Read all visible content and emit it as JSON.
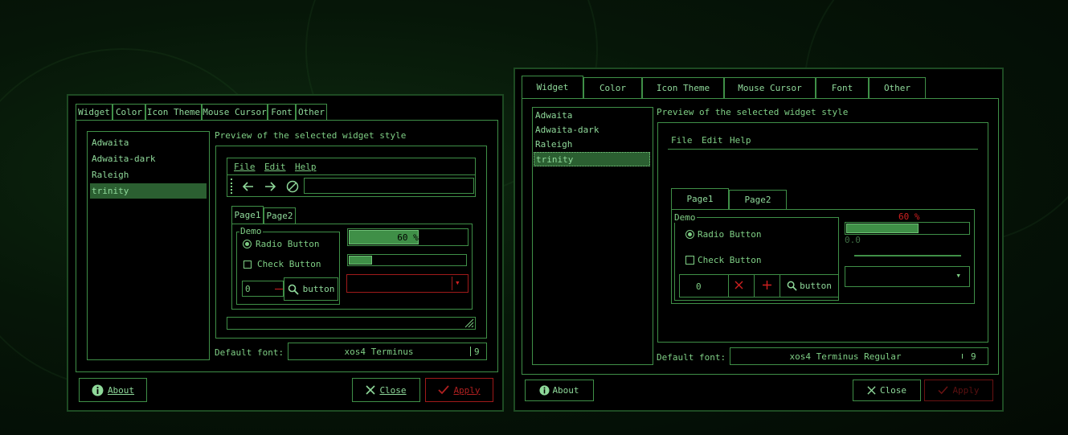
{
  "tabs": [
    "Widget",
    "Color",
    "Icon Theme",
    "Mouse Cursor",
    "Font",
    "Other"
  ],
  "themes": [
    "Adwaita",
    "Adwaita-dark",
    "Raleigh",
    "trinity"
  ],
  "preview_label": "Preview of the selected widget style",
  "menu": [
    "File",
    "Edit",
    "Help"
  ],
  "page_tabs": [
    "Page1",
    "Page2"
  ],
  "demo_label": "Demo",
  "radio_label": "Radio Button",
  "check_label": "Check Button",
  "spin_value": "0",
  "button_label": "button",
  "progress_text": "60 %",
  "progress_fraction": 0.6,
  "right_progress_text": "60 %",
  "scale_value": "0.0",
  "default_font_label": "Default font:",
  "left_font": {
    "name": "xos4 Terminus",
    "size": "9"
  },
  "right_font": {
    "name": "xos4 Terminus Regular",
    "size": "9"
  },
  "about_label": "About",
  "close_label": "Close",
  "apply_label": "Apply",
  "colors": {
    "accent": "#3f8f47",
    "text": "#8fd99a",
    "danger": "#b02020",
    "background": "#000000"
  }
}
